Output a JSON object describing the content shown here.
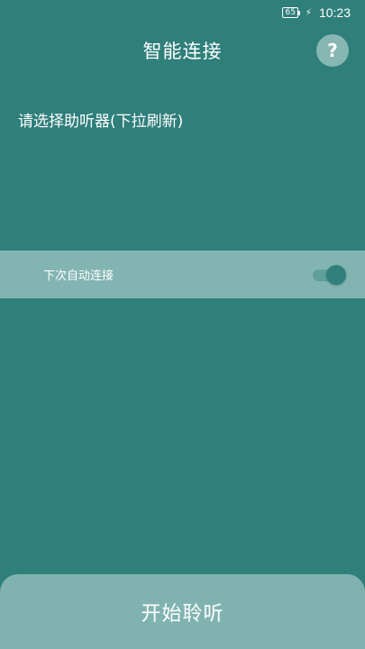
{
  "status_bar": {
    "battery_level": "65",
    "time": "10:23",
    "charging_icon": "bolt-icon"
  },
  "header": {
    "title": "智能连接",
    "help_label": "?"
  },
  "device_section": {
    "label": "请选择助听器(下拉刷新)"
  },
  "auto_connect": {
    "label": "下次自动连接",
    "enabled": true
  },
  "footer": {
    "start_label": "开始聆听"
  },
  "colors": {
    "background": "#2f7f7b",
    "row_highlight": "#82b5b2",
    "button_bg": "#80b3b0",
    "help_bg": "#86b7b3"
  }
}
